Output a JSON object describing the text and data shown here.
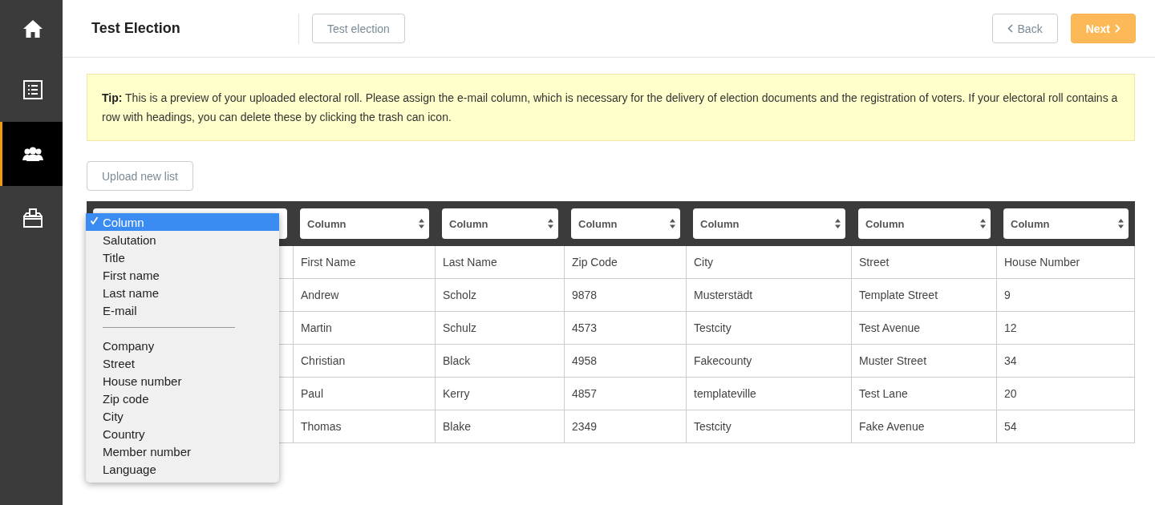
{
  "sidebar": {
    "items": [
      {
        "kind": "home",
        "selected": false
      },
      {
        "kind": "list",
        "selected": false
      },
      {
        "kind": "people",
        "selected": true
      },
      {
        "kind": "ballot",
        "selected": false
      }
    ]
  },
  "header": {
    "title": "Test Election",
    "badge": "Test election",
    "back": "Back",
    "next": "Next"
  },
  "tip": {
    "label": "Tip:",
    "text": "This is a preview of your uploaded electoral roll. Please assign the e-mail column, which is necessary for the delivery of election documents and the registration of voters. If your electoral roll contains a row with headings, you can delete these by clicking the trash can icon."
  },
  "upload_button": "Upload new list",
  "table": {
    "selects": [
      "Column",
      "Column",
      "Column",
      "Column",
      "Column",
      "Column"
    ],
    "rows": [
      [
        "First Name",
        "Last Name",
        "Zip Code",
        "City",
        "Street",
        "House Number"
      ],
      [
        "Andrew",
        "Scholz",
        "9878",
        "Musterstädt",
        "Template Street",
        "9"
      ],
      [
        "Martin",
        "Schulz",
        "4573",
        "Testcity",
        "Test Avenue",
        "12"
      ],
      [
        "Christian",
        "Black",
        "4958",
        "Fakecounty",
        "Muster Street",
        "34"
      ],
      [
        "Paul",
        "Kerry",
        "4857",
        "templateville",
        "Test Lane",
        "20"
      ],
      [
        "Thomas",
        "Blake",
        "2349",
        "Testcity",
        "Fake Avenue",
        "54"
      ]
    ]
  },
  "dropdown": {
    "items": [
      {
        "kind": "option",
        "label": "Column",
        "selected": true
      },
      {
        "kind": "option",
        "label": "Salutation",
        "selected": false
      },
      {
        "kind": "option",
        "label": "Title",
        "selected": false
      },
      {
        "kind": "option",
        "label": "First name",
        "selected": false
      },
      {
        "kind": "option",
        "label": "Last name",
        "selected": false
      },
      {
        "kind": "option",
        "label": "E-mail",
        "selected": false
      },
      {
        "kind": "separator"
      },
      {
        "kind": "option",
        "label": "Company",
        "selected": false
      },
      {
        "kind": "option",
        "label": "Street",
        "selected": false
      },
      {
        "kind": "option",
        "label": "House number",
        "selected": false
      },
      {
        "kind": "option",
        "label": "Zip code",
        "selected": false
      },
      {
        "kind": "option",
        "label": "City",
        "selected": false
      },
      {
        "kind": "option",
        "label": "Country",
        "selected": false
      },
      {
        "kind": "option",
        "label": "Member number",
        "selected": false
      },
      {
        "kind": "option",
        "label": "Language",
        "selected": false
      }
    ]
  }
}
